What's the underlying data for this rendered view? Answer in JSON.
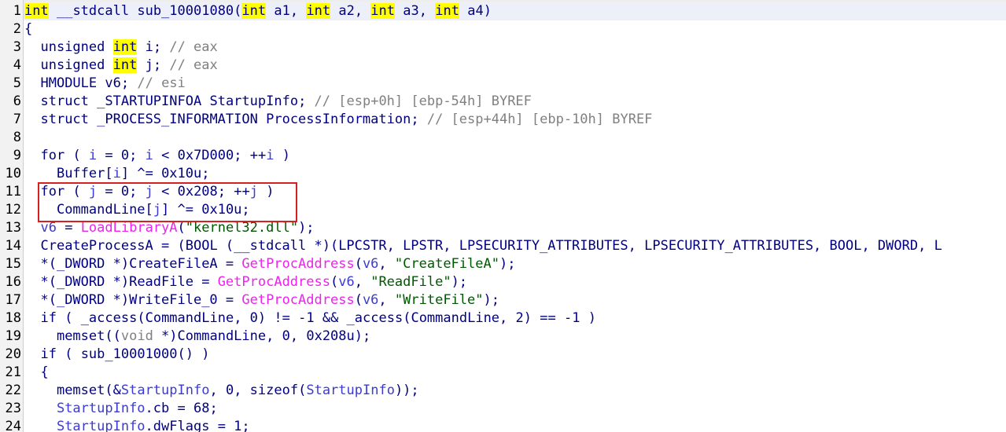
{
  "window": {
    "type": "IDA Pro pseudocode view"
  },
  "colors": {
    "background": "#ffffff",
    "gutter": "#f2f2f2",
    "keyword": "#000080",
    "variable": "#3b3bd4",
    "import": "#ee22ee",
    "string": "#005800",
    "comment": "#808080",
    "highlight": "#ffff00",
    "selection_border": "#d82020"
  },
  "code": {
    "lines": [
      {
        "num": "1",
        "text": "int __stdcall sub_10001080(int a1, int a2, int a3, int a4)"
      },
      {
        "num": "2",
        "text": "{"
      },
      {
        "num": "3",
        "text": "  unsigned int i; // eax"
      },
      {
        "num": "4",
        "text": "  unsigned int j; // eax"
      },
      {
        "num": "5",
        "text": "  HMODULE v6; // esi"
      },
      {
        "num": "6",
        "text": "  struct _STARTUPINFOA StartupInfo; // [esp+0h] [ebp-54h] BYREF"
      },
      {
        "num": "7",
        "text": "  struct _PROCESS_INFORMATION ProcessInformation; // [esp+44h] [ebp-10h] BYREF"
      },
      {
        "num": "8",
        "text": ""
      },
      {
        "num": "9",
        "text": "  for ( i = 0; i < 0x7D000; ++i )"
      },
      {
        "num": "10",
        "text": "    Buffer[i] ^= 0x10u;"
      },
      {
        "num": "11",
        "text": "  for ( j = 0; j < 0x208; ++j )"
      },
      {
        "num": "12",
        "text": "    CommandLine[j] ^= 0x10u;"
      },
      {
        "num": "13",
        "text": "  v6 = LoadLibraryA(\"kernel32.dll\");"
      },
      {
        "num": "14",
        "text": "  CreateProcessA = (BOOL (__stdcall *)(LPCSTR, LPSTR, LPSECURITY_ATTRIBUTES, LPSECURITY_ATTRIBUTES, BOOL, DWORD, L"
      },
      {
        "num": "15",
        "text": "  *(_DWORD *)CreateFileA = GetProcAddress(v6, \"CreateFileA\");"
      },
      {
        "num": "16",
        "text": "  *(_DWORD *)ReadFile = GetProcAddress(v6, \"ReadFile\");"
      },
      {
        "num": "17",
        "text": "  *(_DWORD *)WriteFile_0 = GetProcAddress(v6, \"WriteFile\");"
      },
      {
        "num": "18",
        "text": "  if ( _access(CommandLine, 0) != -1 && _access(CommandLine, 2) == -1 )"
      },
      {
        "num": "19",
        "text": "    memset((void *)CommandLine, 0, 0x208u);"
      },
      {
        "num": "20",
        "text": "  if ( sub_10001000() )"
      },
      {
        "num": "21",
        "text": "  {"
      },
      {
        "num": "22",
        "text": "    memset(&StartupInfo, 0, sizeof(StartupInfo));"
      },
      {
        "num": "23",
        "text": "    StartupInfo.cb = 68;"
      },
      {
        "num": "24",
        "text": "    StartupInfo.dwFlags = 1;"
      }
    ]
  },
  "tokens": {
    "int": "int",
    "stdcall": "__stdcall",
    "func_name": "sub_10001080",
    "a1": "a1",
    "a2": "a2",
    "a3": "a3",
    "a4": "a4",
    "open_brace": "{",
    "unsigned": "unsigned",
    "i": "i",
    "j": "j",
    "eax": "eax",
    "hmodule": "HMODULE",
    "v6": "v6",
    "esi": "esi",
    "struct": "struct",
    "startupinfo_type": "_STARTUPINFOA",
    "startupinfo": "StartupInfo",
    "startupinfo_cmt": "[esp+0h] [ebp-54h] BYREF",
    "procinfo_type": "_PROCESS_INFORMATION",
    "procinfo": "ProcessInformation",
    "procinfo_cmt": "[esp+44h] [ebp-10h] BYREF",
    "for": "for",
    "zero": "0",
    "lim1": "0x7D000",
    "buffer": "Buffer",
    "xor_val": "0x10u",
    "lim2": "0x208",
    "commandline": "CommandLine",
    "loadlibrary": "LoadLibraryA",
    "kernel32": "\"kernel32.dll\"",
    "createprocess": "CreateProcessA",
    "cp_cast": "(BOOL (__stdcall *)(LPCSTR, LPSTR, LPSECURITY_ATTRIBUTES, LPSECURITY_ATTRIBUTES, BOOL, DWORD, L",
    "dword_cast": "*(_DWORD *)",
    "createfile": "CreateFileA",
    "getprocaddress": "GetProcAddress",
    "createfile_str": "\"CreateFileA\"",
    "readfile": "ReadFile",
    "readfile_str": "\"ReadFile\"",
    "writefile0": "WriteFile_0",
    "writefile_str": "\"WriteFile\"",
    "if": "if",
    "access": "_access",
    "neg1": "-1",
    "two": "2",
    "memset": "memset",
    "void_cast": "(void *)",
    "size208": "0x208u",
    "sub_1000": "sub_10001000",
    "sizeof": "sizeof",
    "cb": "cb",
    "sixty_eight": "68",
    "dwflags": "dwFlags",
    "one": "1"
  }
}
